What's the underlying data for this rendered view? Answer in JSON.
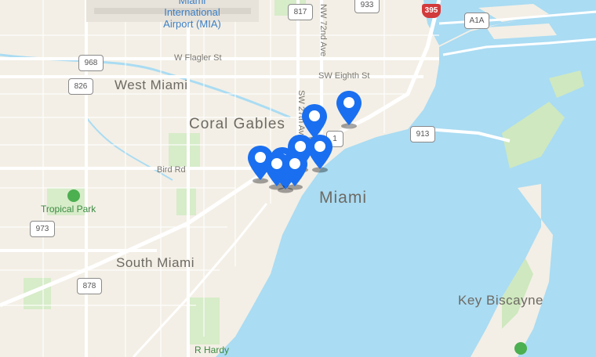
{
  "map": {
    "labels": {
      "airport": "Miami\nInternational\nAirport (MIA)",
      "west_miami": "West Miami",
      "coral_gables": "Coral Gables",
      "miami": "Miami",
      "south_miami": "South Miami",
      "key_biscayne": "Key Biscayne",
      "tropical_park": "Tropical Park",
      "r_hardy": "R Hardy",
      "w_flagler": "W Flagler St",
      "sw_eighth": "SW Eighth St",
      "bird_rd": "Bird Rd",
      "nw_72_ave": "NW 72nd Ave",
      "sw_27_ave": "SW 27th Ave"
    },
    "shields": {
      "r968": "968",
      "r826": "826",
      "r817": "817",
      "r933": "933",
      "i395": "395",
      "a1a": "A1A",
      "r913": "913",
      "r973": "973",
      "r878": "878",
      "us1": "1"
    },
    "markers_count": 9,
    "colors": {
      "water": "#aadcf3",
      "land": "#f3efe6",
      "park": "#cfe8bf",
      "marker": "#1a6ff0"
    }
  }
}
